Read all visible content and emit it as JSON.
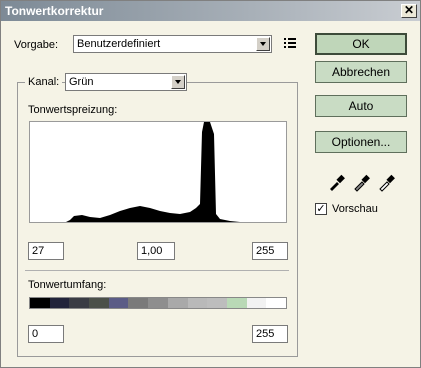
{
  "window": {
    "title": "Tonwertkorrektur",
    "close": "✕"
  },
  "vorgabe": {
    "label": "Vorgabe:",
    "value": "Benutzerdefiniert"
  },
  "kanal": {
    "label": "Kanal:",
    "value": "Grün"
  },
  "tonwertspreizung": {
    "label": "Tonwertspreizung:",
    "black": "27",
    "gamma": "1,00",
    "white": "255"
  },
  "tonwertumfang": {
    "label": "Tonwertumfang:",
    "low": "0",
    "high": "255",
    "ramp_colors": [
      "#000000",
      "#22243a",
      "#3a3c44",
      "#4b5049",
      "#5b5c86",
      "#7a7a7a",
      "#8e8e8e",
      "#a9a9a9",
      "#b9b9b9",
      "#bdbdbd",
      "#b9d9b6",
      "#f2f2f2",
      "#ffffff"
    ]
  },
  "buttons": {
    "ok": "OK",
    "abbrechen": "Abbrechen",
    "auto": "Auto",
    "optionen": "Optionen..."
  },
  "vorschau": {
    "label": "Vorschau",
    "checked": true,
    "mark": "✓"
  },
  "icons": [
    "preset-options-icon",
    "black-eyedropper-icon",
    "gray-eyedropper-icon",
    "white-eyedropper-icon"
  ]
}
